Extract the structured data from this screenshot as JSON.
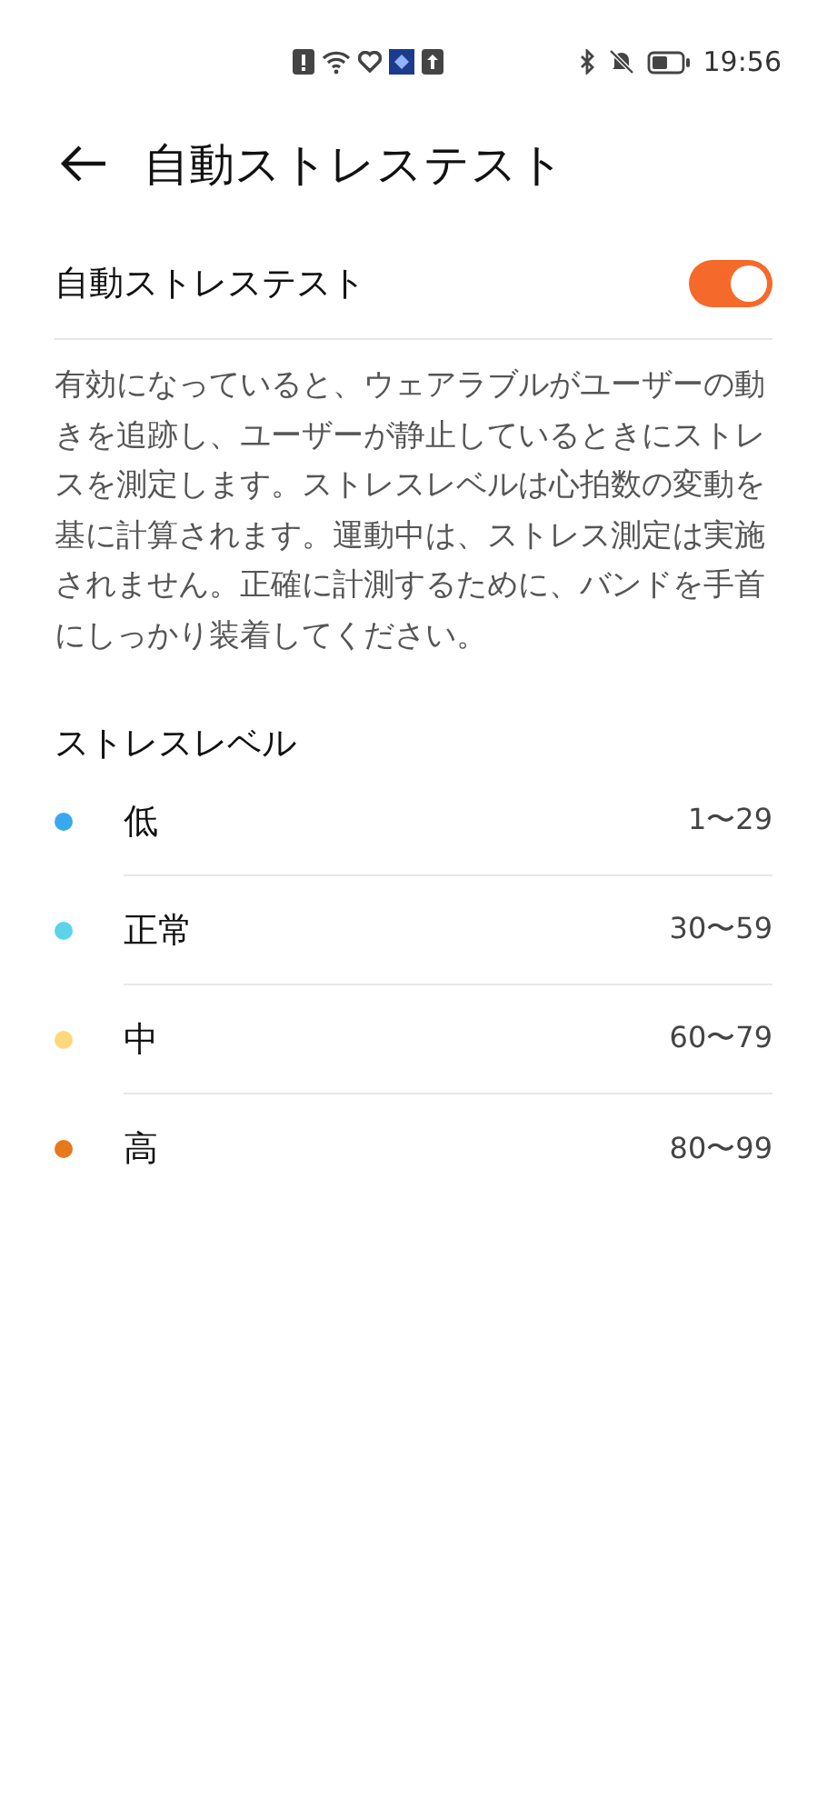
{
  "status_bar": {
    "time": "19:56"
  },
  "header": {
    "title": "自動ストレステスト"
  },
  "setting": {
    "label": "自動ストレステスト",
    "on": true
  },
  "description": "有効になっていると、ウェアラブルがユーザーの動きを追跡し、ユーザーが静止しているときにストレスを測定します。ストレスレベルは心拍数の変動を基に計算されます。運動中は、ストレス測定は実施されません。正確に計測するために、バンドを手首にしっかり装着してください。",
  "levels_title": "ストレスレベル",
  "levels": [
    {
      "name": "低",
      "range": "1〜29",
      "color": "#3aa8ee"
    },
    {
      "name": "正常",
      "range": "30〜59",
      "color": "#5dd3ea"
    },
    {
      "name": "中",
      "range": "60〜79",
      "color": "#fcd97a"
    },
    {
      "name": "高",
      "range": "80〜99",
      "color": "#e6791c"
    }
  ]
}
